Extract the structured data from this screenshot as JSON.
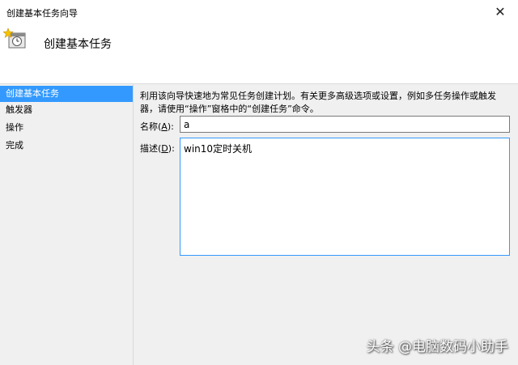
{
  "window": {
    "title": "创建基本任务向导",
    "close_glyph": "✕"
  },
  "header": {
    "title": "创建基本任务",
    "icon": "task-clock-icon"
  },
  "nav": {
    "items": [
      {
        "label": "创建基本任务",
        "selected": true
      },
      {
        "label": "触发器",
        "selected": false
      },
      {
        "label": "操作",
        "selected": false
      },
      {
        "label": "完成",
        "selected": false
      }
    ]
  },
  "main": {
    "description": "利用该向导快速地为常见任务创建计划。有关更多高级选项或设置，例如多任务操作或触发器，请使用“操作”窗格中的“创建任务”命令。",
    "name_label": "名称(",
    "name_accel": "A",
    "name_label_end": "):",
    "name_value": "a",
    "desc_label": "描述(",
    "desc_accel": "D",
    "desc_label_end": "):",
    "desc_value": "win10定时关机"
  },
  "watermark": "头条 @电脑数码小助手",
  "colors": {
    "selection": "#3399ff",
    "focus_border": "#3399ff"
  }
}
